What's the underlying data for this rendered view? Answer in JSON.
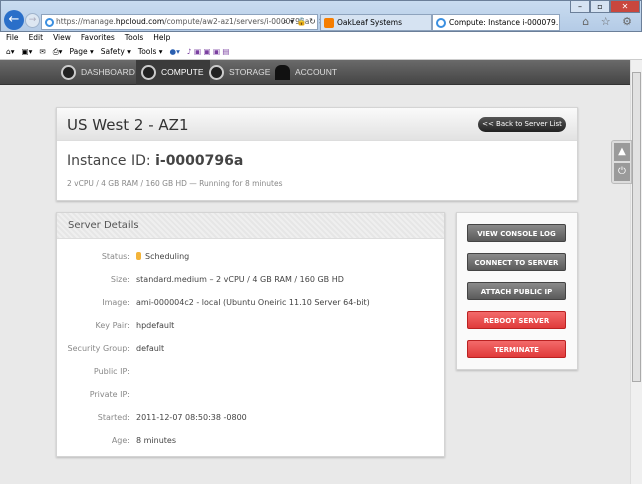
{
  "browser": {
    "url_prefix": "https://manage.",
    "url_domain": "hpcloud.com",
    "url_path": "/compute/aw2-az1/servers/i-0000796a",
    "address_controls": "⌕ ▾ 🔒 ↻ ✕",
    "tabs": [
      {
        "label": "OakLeaf Systems"
      },
      {
        "label": "Compute: Instance i-000079...",
        "close": "✕"
      }
    ],
    "window_buttons": [
      "–",
      "▫",
      "✕"
    ],
    "toolbar_icons": "⌂ ☆ ⚙",
    "menu": [
      "File",
      "Edit",
      "View",
      "Favorites",
      "Tools",
      "Help"
    ],
    "commands": [
      "Page ▾",
      "Safety ▾",
      "Tools ▾"
    ]
  },
  "nav": [
    {
      "label": "DASHBOARD"
    },
    {
      "label": "COMPUTE"
    },
    {
      "label": "STORAGE"
    },
    {
      "label": "ACCOUNT"
    }
  ],
  "header": {
    "region": "US West 2 - AZ1",
    "back_button": "<< Back to Server List",
    "instance_label": "Instance ID:",
    "instance_id": "i-0000796a",
    "spec": "2 vCPU / 4 GB RAM / 160 GB HD — Running for 8 minutes"
  },
  "details": {
    "title": "Server Details",
    "rows": [
      {
        "label": "Status:",
        "value": "Scheduling"
      },
      {
        "label": "Size:",
        "value": "standard.medium – 2 vCPU / 4 GB RAM / 160 GB HD"
      },
      {
        "label": "Image:",
        "value": "ami-000004c2 - local (Ubuntu Oneiric 11.10 Server 64-bit)"
      },
      {
        "label": "Key Pair:",
        "value": "hpdefault"
      },
      {
        "label": "Security Group:",
        "value": "default"
      },
      {
        "label": "Public IP:",
        "value": ""
      },
      {
        "label": "Private IP:",
        "value": ""
      },
      {
        "label": "Started:",
        "value": "2011-12-07 08:50:38 -0800"
      },
      {
        "label": "Age:",
        "value": "8 minutes"
      }
    ],
    "status_color": "#f3b43a"
  },
  "actions": [
    {
      "label": "VIEW CONSOLE LOG"
    },
    {
      "label": "CONNECT TO SERVER"
    },
    {
      "label": "ATTACH PUBLIC IP"
    },
    {
      "label": "REBOOT SERVER"
    },
    {
      "label": "TERMINATE"
    }
  ]
}
